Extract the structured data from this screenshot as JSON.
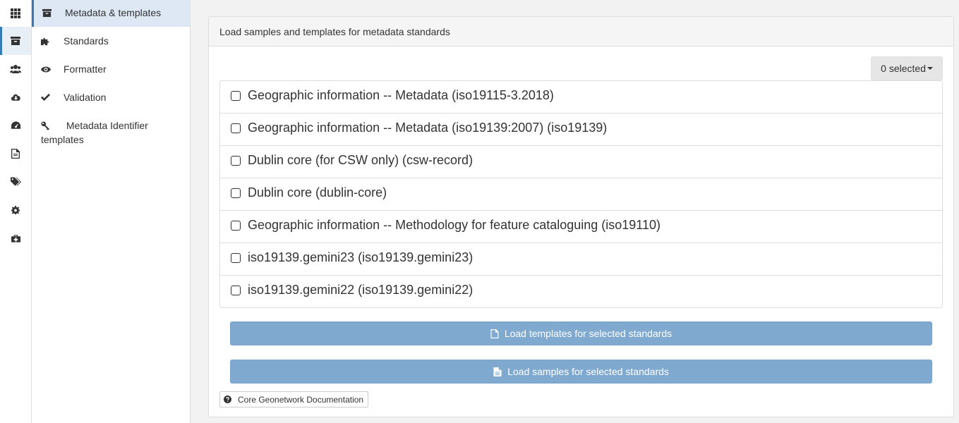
{
  "rail": {
    "items": [
      {
        "icon": "apps-grid-icon"
      },
      {
        "icon": "archive-box-icon"
      },
      {
        "icon": "users-icon"
      },
      {
        "icon": "cloud-download-icon"
      },
      {
        "icon": "dashboard-icon"
      },
      {
        "icon": "file-text-icon"
      },
      {
        "icon": "tags-icon"
      },
      {
        "icon": "gear-icon"
      },
      {
        "icon": "medkit-icon"
      }
    ]
  },
  "subnav": {
    "items": [
      {
        "label": "Metadata & templates",
        "icon": "archive-box-icon",
        "active": true
      },
      {
        "label": "Standards",
        "icon": "puzzle-icon"
      },
      {
        "label": "Formatter",
        "icon": "eye-icon"
      },
      {
        "label": "Validation",
        "icon": "check-icon"
      },
      {
        "label": "Metadata Identifier templates",
        "icon": "key-icon"
      }
    ]
  },
  "panel": {
    "title": "Load samples and templates for metadata standards",
    "selected_label": "0 selected",
    "standards": [
      "Geographic information -- Metadata (iso19115-3.2018)",
      "Geographic information -- Metadata (iso19139:2007) (iso19139)",
      "Dublin core (for CSW only) (csw-record)",
      "Dublin core (dublin-core)",
      "Geographic information -- Methodology for feature cataloguing (iso19110)",
      "iso19139.gemini23 (iso19139.gemini23)",
      "iso19139.gemini22 (iso19139.gemini22)"
    ],
    "load_templates_label": "Load templates for selected standards",
    "load_samples_label": "Load samples for selected standards",
    "doc_link_label": "Core Geonetwork Documentation"
  },
  "colors": {
    "accent": "#337ab7",
    "button_disabled": "#7fa9cf"
  }
}
